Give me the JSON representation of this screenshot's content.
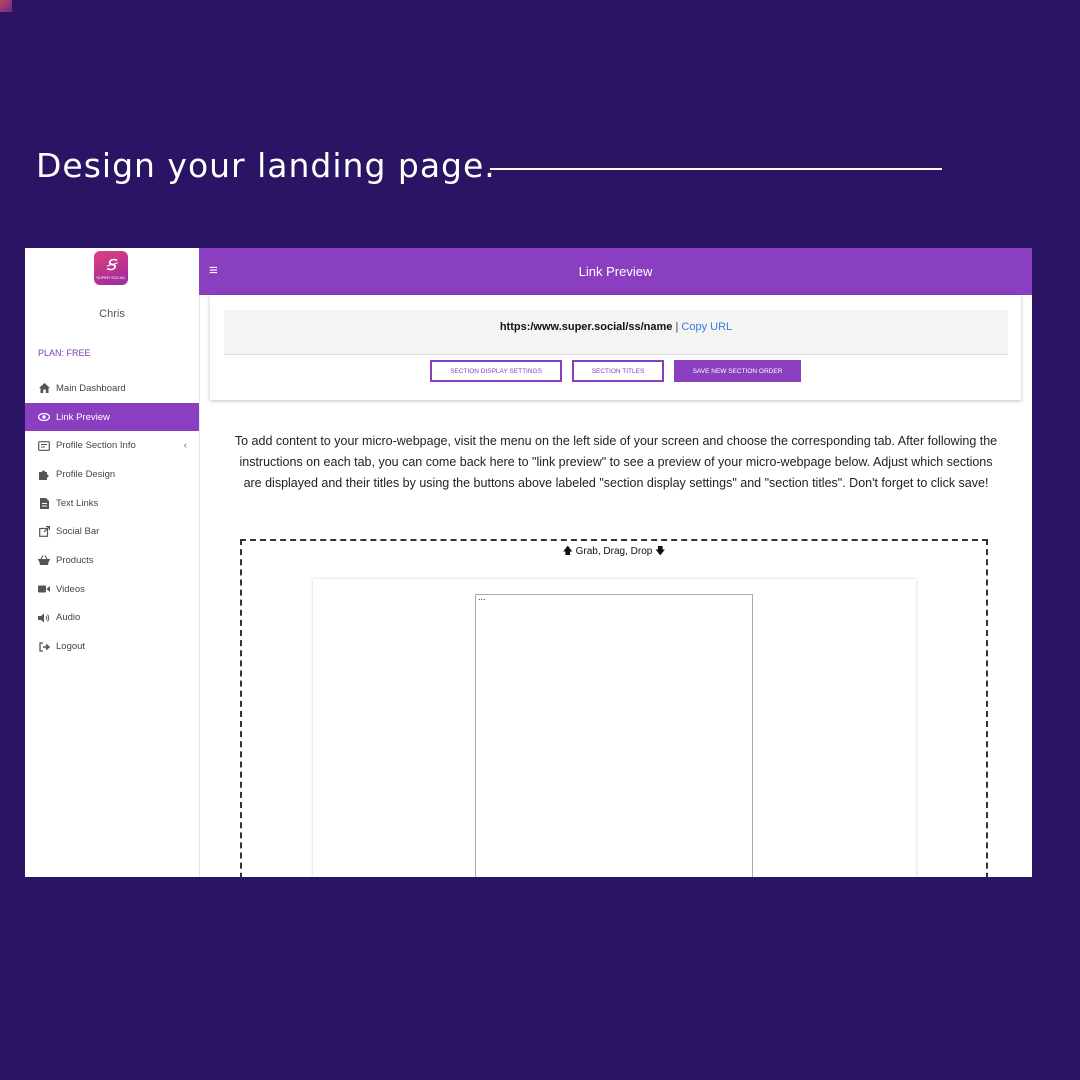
{
  "headline": "Design your landing page.",
  "sidebar": {
    "logo_text": "SUPER SOCIAL",
    "user_name": "Chris",
    "plan": "PLAN: FREE",
    "items": [
      {
        "label": "Main Dashboard",
        "icon": "home-icon"
      },
      {
        "label": "Link Preview",
        "icon": "eye-icon",
        "active": true
      },
      {
        "label": "Profile Section Info",
        "icon": "id-card-icon"
      },
      {
        "label": "Profile Design",
        "icon": "puzzle-icon"
      },
      {
        "label": "Text Links",
        "icon": "document-icon"
      },
      {
        "label": "Social Bar",
        "icon": "external-link-icon"
      },
      {
        "label": "Products",
        "icon": "basket-icon"
      },
      {
        "label": "Videos",
        "icon": "video-camera-icon"
      },
      {
        "label": "Audio",
        "icon": "volume-icon"
      },
      {
        "label": "Logout",
        "icon": "sign-out-icon"
      }
    ]
  },
  "topbar": {
    "title": "Link Preview"
  },
  "link_card": {
    "url": "https:/www.super.social/ss/name",
    "separator": " | ",
    "copy_label": "Copy URL",
    "buttons": {
      "display_settings": "SECTION DISPLAY SETTINGS",
      "section_titles": "SECTION TITLES",
      "save_order": "SAVE NEW SECTION ORDER"
    }
  },
  "instructions": "To add content to your micro-webpage, visit the menu on the left side of your screen and choose the corresponding tab. After following the instructions on each tab, you can come back here to \"link preview\" to see a preview of your micro-webpage below. Adjust which sections are displayed and their titles by using the buttons above labeled \"section display settings\" and \"section titles\". Don't forget to click save!",
  "drop_zone": {
    "label": "Grab, Drag, Drop"
  },
  "preview": {
    "placeholder": "..."
  },
  "colors": {
    "background": "#2a1463",
    "accent": "#8a3fc0",
    "link": "#2f7fd8"
  }
}
